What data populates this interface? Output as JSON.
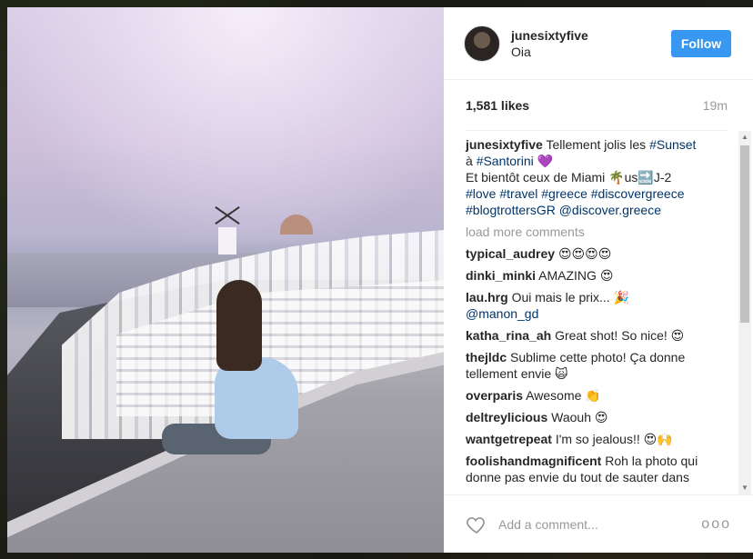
{
  "post": {
    "username": "junesixtyfive",
    "location": "Oia",
    "follow_label": "Follow",
    "likes": "1,581 likes",
    "time": "19m"
  },
  "caption": {
    "username": "junesixtyfive",
    "t1": "Tellement jolis les",
    "tag_sunset": "#Sunset",
    "t2": "à",
    "tag_santorini": "#Santorini",
    "e_heart": "💜",
    "t3": "Et bientôt ceux de Miami",
    "e_palm": "🌴",
    "e_us": "us",
    "e_soon": "🔜",
    "t4": "J-2",
    "tags_line": "#love #travel #greece #discovergreece",
    "tags_line2": "#blogtrottersGR @discover.greece"
  },
  "load_more": "load more comments",
  "comments": [
    {
      "user": "typical_audrey",
      "text": "😍😍😍😍"
    },
    {
      "user": "dinki_minki",
      "text": "AMAZING 😍"
    },
    {
      "user": "lau.hrg",
      "text": "Oui mais le prix... 🎉",
      "mention": "@manon_gd"
    },
    {
      "user": "katha_rina_ah",
      "text": "Great shot! So nice! 😍"
    },
    {
      "user": "thejldc",
      "text": "Sublime cette photo! Ça donne tellement envie 🙀"
    },
    {
      "user": "overparis",
      "text": "Awesome 👏"
    },
    {
      "user": "deltreylicious",
      "text": "Waouh 😍"
    },
    {
      "user": "wantgetrepeat",
      "text": "I'm so jealous!! 😍🙌"
    },
    {
      "user": "foolishandmagnificent",
      "text": "Roh la photo qui donne pas envie du tout de sauter dans"
    }
  ],
  "footer": {
    "placeholder": "Add a comment...",
    "more": "ooo"
  },
  "icons": {
    "heart": "heart-outline-icon",
    "more": "more-options-icon"
  },
  "colors": {
    "follow": "#3897f0",
    "hashtag": "#003569"
  }
}
